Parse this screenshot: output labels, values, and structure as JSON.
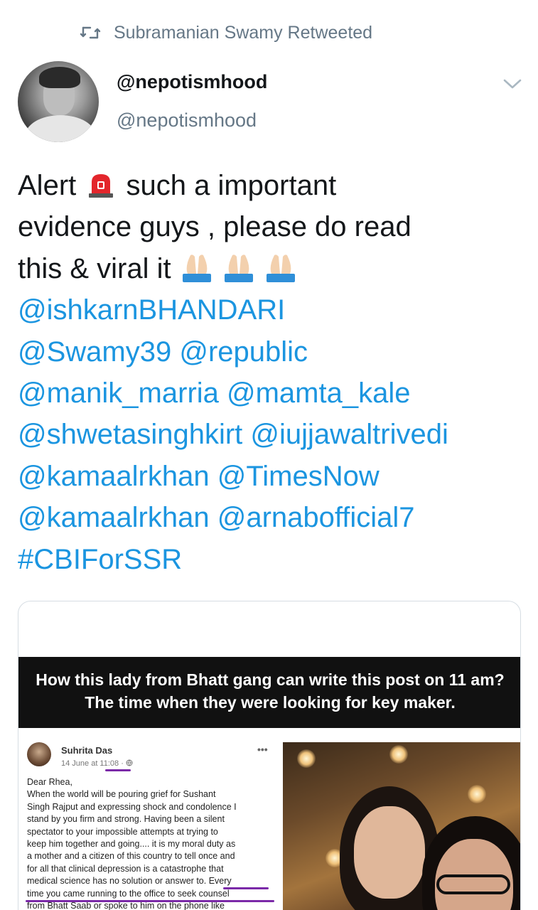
{
  "retweet": {
    "icon": "retweet-icon",
    "text": "Subramanian Swamy Retweeted"
  },
  "author": {
    "display_name": "@nepotismhood",
    "handle": "@nepotismhood"
  },
  "tweet": {
    "line1_a": "Alert",
    "line1_b": "such a important",
    "line2": "evidence guys , please do read",
    "line3": "this & viral it",
    "line4": "@ishkarnBHANDARI",
    "line5": "@Swamy39 @republic",
    "line6": "@manik_marria @mamta_kale",
    "line7": "@shwetasinghkirt @iujjawaltrivedi",
    "line8": "@kamaalrkhan @TimesNow",
    "line9": "@kamaalrkhan @arnabofficial7",
    "line10": "#CBIForSSR",
    "emoji_siren": "police-siren-icon",
    "emoji_pray": "folded-hands-icon"
  },
  "media": {
    "banner_line1": "How this lady from Bhatt gang can write this post on 11 am?",
    "banner_line2": "The time when they were looking for key maker.",
    "fb_post": {
      "name": "Suhrita Das",
      "date": "14 June at 11:08 · ",
      "more": "•••",
      "body": [
        "Dear Rhea,",
        "When the world will be pouring grief for Sushant",
        "Singh Rajput and expressing shock and condolence I",
        "stand by you firm and strong. Having been a silent",
        "spectator to your impossible attempts at trying to",
        "keep him together and going.... it is my moral duty as",
        "a mother and a citizen of this country to tell once and",
        "for all that clinical depression is a catastrophe that",
        "medical science has no solution or answer to. Every",
        "time you came running to the office to seek counsel",
        "from Bhatt Saab or spoke to him on the phone like"
      ]
    }
  },
  "colors": {
    "link": "#1b95e0",
    "muted": "#657786",
    "text": "#14171a",
    "annotation": "#7b2aa8"
  }
}
